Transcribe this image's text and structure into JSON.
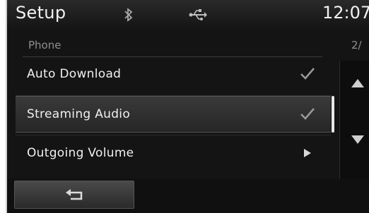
{
  "header": {
    "title": "Setup",
    "clock": "12:07",
    "icons": [
      "bluetooth-icon",
      "usb-icon"
    ]
  },
  "section": {
    "title": "Phone",
    "page_indicator": "2/"
  },
  "list": {
    "items": [
      {
        "label": "Auto Download",
        "control": "check-icon",
        "checked": true,
        "selected": false
      },
      {
        "label": "Streaming Audio",
        "control": "check-icon",
        "checked": true,
        "selected": true
      },
      {
        "label": "Outgoing Volume",
        "control": "arrow-right-icon",
        "selected": false
      }
    ]
  },
  "scroll": {
    "up": "scroll-up-icon",
    "down": "scroll-down-icon"
  },
  "bottom": {
    "back": "back-arrow-icon"
  },
  "colors": {
    "background": "#141414",
    "text": "#f0f0f0",
    "muted": "#8f8f8f",
    "selected_row": "#333333"
  }
}
